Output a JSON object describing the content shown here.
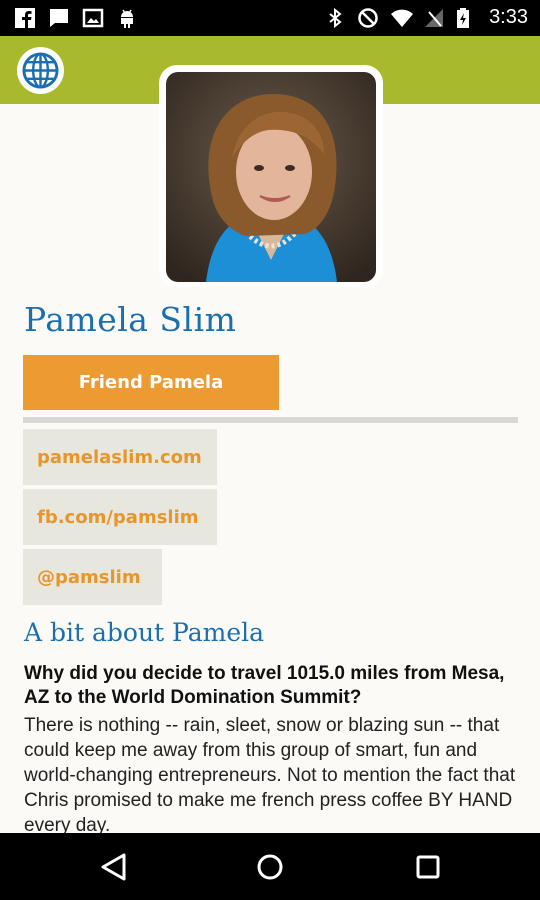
{
  "status_bar": {
    "time": "3:33",
    "left_icons": [
      "facebook-icon",
      "chat-icon",
      "image-icon",
      "android-icon"
    ],
    "right_icons": [
      "bluetooth-icon",
      "do-not-disturb-icon",
      "wifi-icon",
      "signal-icon",
      "battery-icon"
    ]
  },
  "app_bar": {
    "icon": "globe-icon"
  },
  "profile": {
    "name": "Pamela Slim",
    "friend_button": "Friend Pamela",
    "links": [
      "pamelaslim.com",
      "fb.com/pamslim",
      "@pamslim"
    ]
  },
  "about": {
    "title": "A bit about Pamela",
    "question": "Why did you decide to travel 1015.0 miles from Mesa, AZ to the World Domination Summit?",
    "answer": "There is nothing -- rain, sleet, snow or blazing sun -- that could keep me away from this group of smart, fun and world-changing entrepreneurs. Not to mention the fact that Chris promised to make me french press coffee BY HAND every day."
  },
  "nav_bar": {
    "icons": [
      "back-icon",
      "home-icon",
      "recents-icon"
    ]
  },
  "colors": {
    "accent_green": "#a8b92b",
    "title_blue": "#1c6fae",
    "button_orange": "#ec9a32",
    "link_orange": "#e8962c",
    "chip_bg": "#e8e7dd"
  }
}
